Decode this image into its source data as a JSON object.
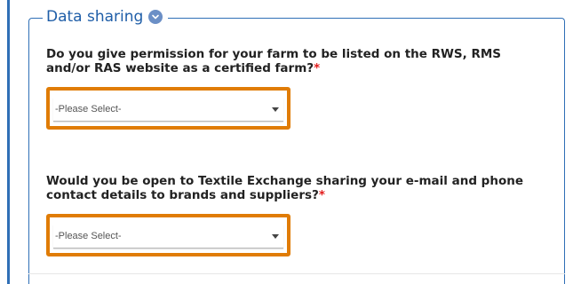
{
  "section": {
    "legend": "Data sharing",
    "info_icon": "chevron-down-icon"
  },
  "questions": [
    {
      "text": "Do you give permission for your farm to be listed on the RWS, RMS and/or RAS website as a certified farm?",
      "required_marker": "*",
      "select_value": "-Please Select-"
    },
    {
      "text": "Would you be open to Textile Exchange sharing your e-mail and phone contact details to brands and suppliers?",
      "required_marker": "*",
      "select_value": "-Please Select-"
    }
  ],
  "colors": {
    "accent": "#2f6fb6",
    "highlight": "#e07c06",
    "required": "#e21c1c"
  }
}
